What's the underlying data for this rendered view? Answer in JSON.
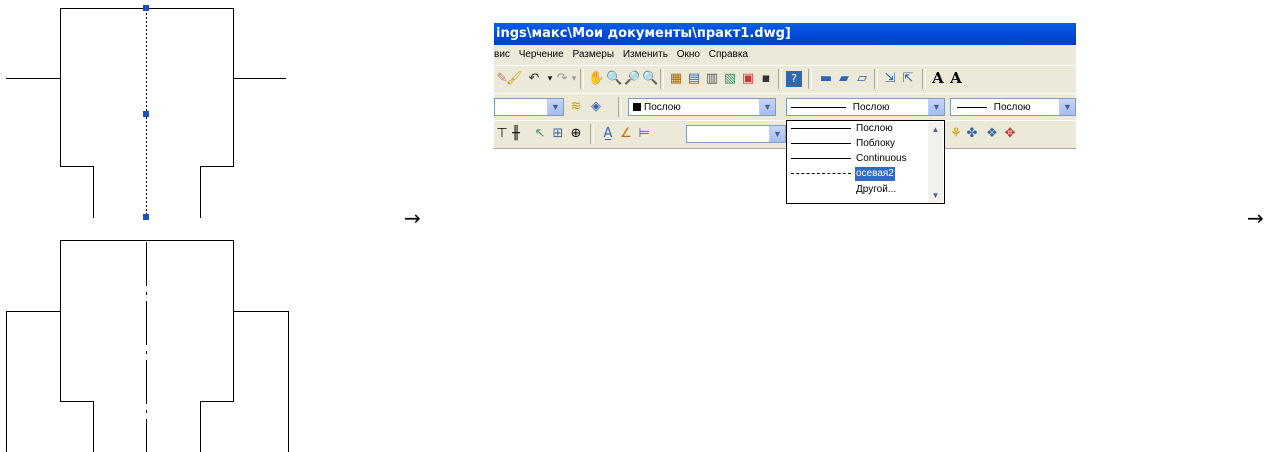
{
  "arrows": [
    "→",
    "→"
  ],
  "window": {
    "title": "ings\\макс\\Мои документы\\практ1.dwg]",
    "menu": [
      "вис",
      "Черчение",
      "Размеры",
      "Изменить",
      "Окно",
      "Справка"
    ]
  },
  "toolbar": {
    "color_combo": "Послою",
    "linetype_combo": "Послою",
    "lineweight_combo": "Послою",
    "text_letters": [
      "A",
      "A"
    ]
  },
  "linetype_dropdown": {
    "items": [
      {
        "label": "Послою",
        "style": "solid"
      },
      {
        "label": "Поблоку",
        "style": "solid"
      },
      {
        "label": "Continuous",
        "style": "solid"
      },
      {
        "label": "осевая2",
        "style": "dashdot",
        "selected": true
      },
      {
        "label": "Другой...",
        "style": "none"
      }
    ]
  },
  "colors": {
    "titlebar": "#0047d6",
    "selection": "#316ac5",
    "grip": "#1f4fbf",
    "toolbar_bg": "#ece9d8"
  }
}
